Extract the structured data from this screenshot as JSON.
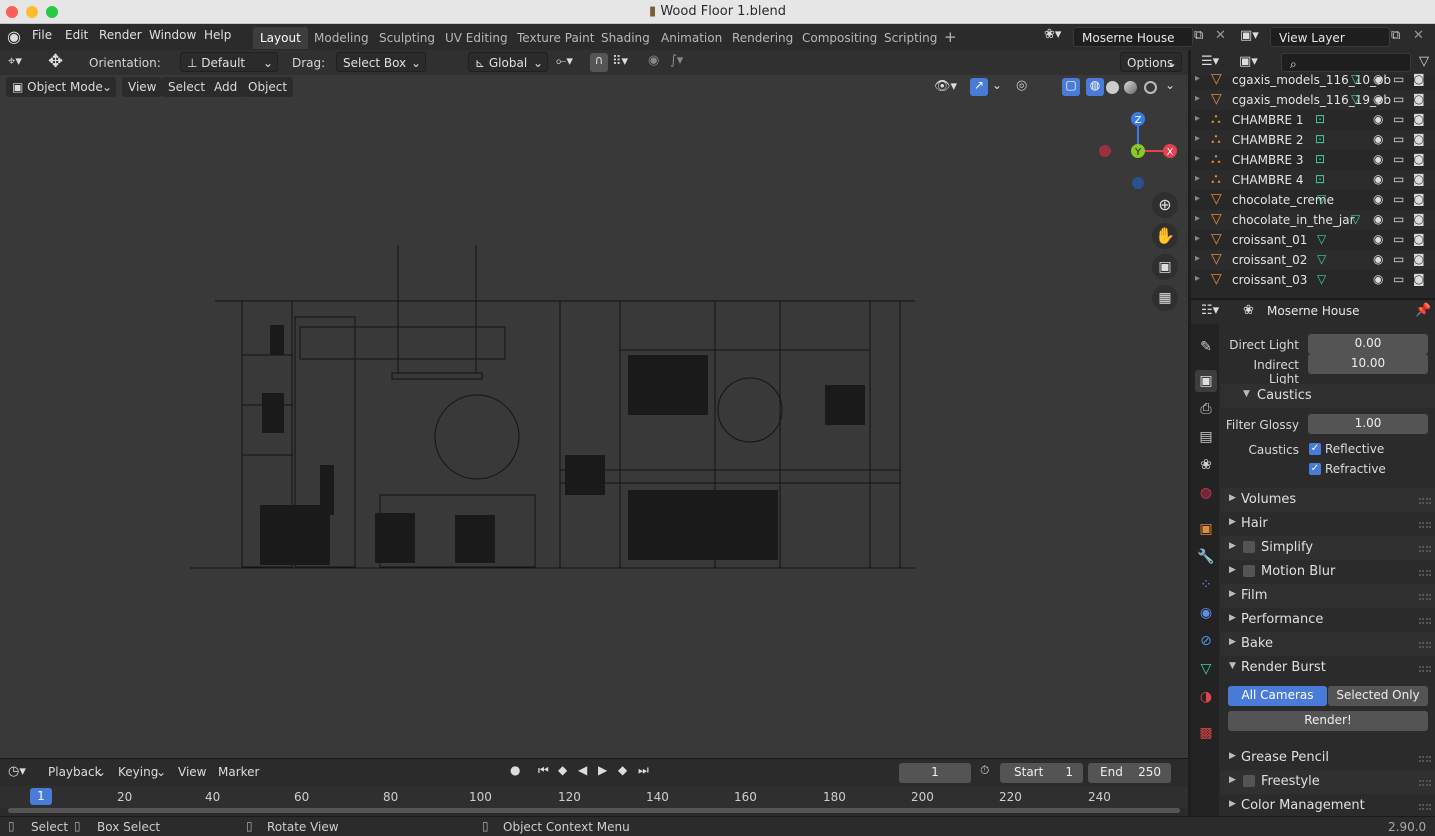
{
  "window": {
    "title": "Wood Floor 1.blend"
  },
  "menu": [
    "File",
    "Edit",
    "Render",
    "Window",
    "Help"
  ],
  "workspaces": [
    "Layout",
    "Modeling",
    "Sculpting",
    "UV Editing",
    "Texture Paint",
    "Shading",
    "Animation",
    "Rendering",
    "Compositing",
    "Scripting"
  ],
  "active_workspace": "Layout",
  "scene": "Moserne House",
  "view_layer": "View Layer",
  "tool_header": {
    "orientation_label": "Orientation:",
    "orientation_value": "Default",
    "drag_label": "Drag:",
    "drag_value": "Select Box",
    "transform": "Global",
    "options": "Options"
  },
  "viewport_header": {
    "mode": "Object Mode",
    "menus": [
      "View",
      "Select",
      "Add",
      "Object"
    ]
  },
  "gizmo": {
    "z": "Z",
    "y": "Y",
    "x": "X"
  },
  "outliner": {
    "items": [
      {
        "name": "cgaxis_models_116_10_ob",
        "type": "mesh"
      },
      {
        "name": "cgaxis_models_116_19_ob",
        "type": "mesh"
      },
      {
        "name": "CHAMBRE 1",
        "type": "camera"
      },
      {
        "name": "CHAMBRE 2",
        "type": "camera"
      },
      {
        "name": "CHAMBRE 3",
        "type": "camera"
      },
      {
        "name": "CHAMBRE 4",
        "type": "camera"
      },
      {
        "name": "chocolate_creme",
        "type": "mesh"
      },
      {
        "name": "chocolate_in_the_jar",
        "type": "mesh"
      },
      {
        "name": "croissant_01",
        "type": "mesh"
      },
      {
        "name": "croissant_02",
        "type": "mesh"
      },
      {
        "name": "croissant_03",
        "type": "mesh"
      }
    ]
  },
  "properties": {
    "scene_name": "Moserne House",
    "direct_light_label": "Direct Light",
    "direct_light": "0.00",
    "indirect_light_label": "Indirect Light",
    "indirect_light": "10.00",
    "caustics_panel": "Caustics",
    "filter_glossy_label": "Filter Glossy",
    "filter_glossy": "1.00",
    "caustics_label": "Caustics",
    "reflective": "Reflective",
    "refractive": "Refractive",
    "reflective_checked": true,
    "refractive_checked": true,
    "panels_a": [
      "Volumes",
      "Hair"
    ],
    "simplify": "Simplify",
    "motion_blur": "Motion Blur",
    "panels_b": [
      "Film",
      "Performance",
      "Bake"
    ],
    "render_burst": "Render Burst",
    "all_cameras": "All Cameras",
    "selected_only": "Selected Only",
    "render_button": "Render!",
    "grease_pencil": "Grease Pencil",
    "freestyle": "Freestyle",
    "color_management": "Color Management"
  },
  "timeline": {
    "menus": [
      "Playback",
      "Keying",
      "View",
      "Marker"
    ],
    "current_frame": "1",
    "start_label": "Start",
    "start": "1",
    "end_label": "End",
    "end": "250",
    "ruler": [
      "1",
      "20",
      "40",
      "60",
      "80",
      "100",
      "120",
      "140",
      "160",
      "180",
      "200",
      "220",
      "240"
    ]
  },
  "status": {
    "select": "Select",
    "box_select": "Box Select",
    "rotate_view": "Rotate View",
    "context_menu": "Object Context Menu",
    "version": "2.90.0"
  },
  "colors": {
    "accent": "#4a7bd8",
    "x_axis": "#e5404f",
    "y_axis": "#8bc825",
    "z_axis": "#3b7ce3",
    "mesh_icon": "#e08c3a",
    "data_icon": "#3fd3a0"
  }
}
